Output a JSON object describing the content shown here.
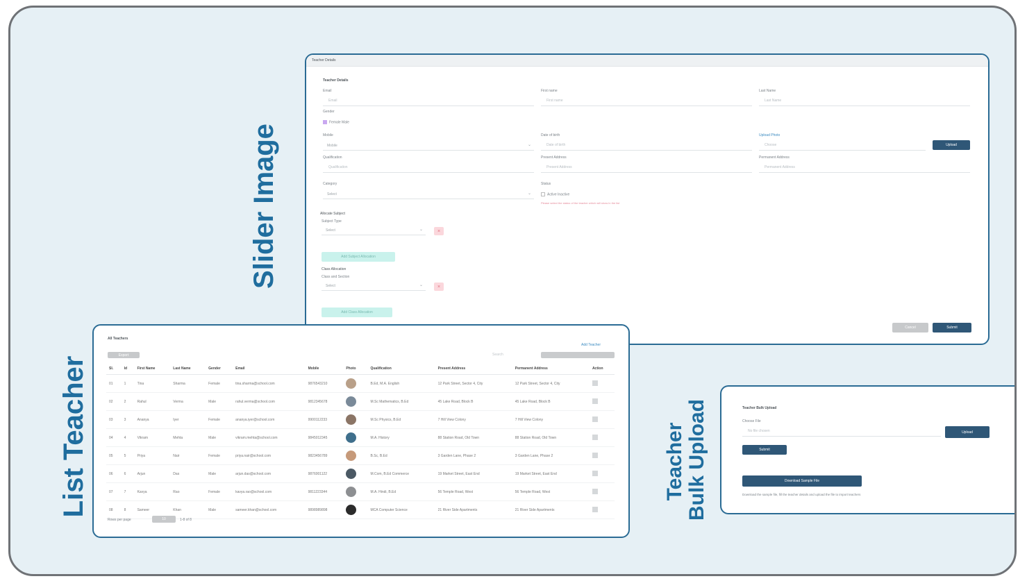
{
  "labels": {
    "slider_image": "Slider Image",
    "list_teacher": "List Teacher",
    "teacher_bulk_upload_line1": "Teacher",
    "teacher_bulk_upload_line2": "Bulk Upload"
  },
  "colors": {
    "accent": "#1f6d9e",
    "panel_border": "#2a6b94",
    "button_dark": "#2f5777",
    "button_mint": "#c9f2ec",
    "button_pink": "#fbd7dc",
    "frame_bg": "#e6f0f5"
  },
  "form_panel": {
    "topbar": "Teacher Details",
    "section_title": "Teacher Details",
    "email_label": "Email",
    "email_placeholder": "Email",
    "first_name_label": "First name",
    "first_name_placeholder": "First name",
    "last_name_label": "Last Name",
    "last_name_placeholder": "Last Name",
    "gender_label": "Gender",
    "gender_options": "Female Male",
    "mobile_label": "Mobile",
    "mobile_placeholder": "Mobile",
    "dob_label": "Date of birth",
    "dob_placeholder": "Date of birth",
    "upload_label": "Upload Photo",
    "upload_placeholder": "Choose",
    "upload_button": "Upload",
    "qualification_label": "Qualification",
    "qualification_placeholder": "Qualification",
    "present_address_label": "Present Address",
    "present_address_placeholder": "Present Address",
    "permanent_address_label": "Permanent Address",
    "permanent_address_placeholder": "Permanent Address",
    "category_label": "Category",
    "category_value": "Select",
    "status_label": "Status",
    "status_options": "Active Inactive",
    "status_hint": "Please select the status of the teacher which will show in the list",
    "subjects_title": "Allocate Subject",
    "subject_type_label": "Subject Type",
    "subject_type_value": "Select",
    "add_subject_button": "Add Subject Allocation",
    "class_title": "Class Allocation",
    "class_label": "Class and Section",
    "class_value": "Select",
    "add_class_button": "Add Class Allocation",
    "cancel_button": "Cancel",
    "submit_button": "Submit"
  },
  "list_panel": {
    "title": "All Teachers",
    "top_left_button": "Export",
    "search_placeholder": "Search",
    "link_text": "Add Teacher",
    "columns": [
      "Sl.",
      "Id",
      "First Name",
      "Last Name",
      "Gender",
      "Email",
      "Mobile",
      "Photo",
      "Qualification",
      "Present Address",
      "Permanent Address",
      "Action"
    ],
    "rows": [
      [
        "01",
        "1",
        "Tina",
        "Sharma",
        "Female",
        "tina.sharma@school.com",
        "9876543210",
        "",
        "B.Ed, M.A. English",
        "12 Park Street, Sector 4, City",
        "12 Park Street, Sector 4, City"
      ],
      [
        "02",
        "2",
        "Rahul",
        "Verma",
        "Male",
        "rahul.verma@school.com",
        "9812345678",
        "",
        "M.Sc Mathematics, B.Ed",
        "45 Lake Road, Block B",
        "45 Lake Road, Block B"
      ],
      [
        "03",
        "3",
        "Ananya",
        "Iyer",
        "Female",
        "ananya.iyer@school.com",
        "9900112233",
        "",
        "M.Sc Physics, B.Ed",
        "7 Hill View Colony",
        "7 Hill View Colony"
      ],
      [
        "04",
        "4",
        "Vikram",
        "Mehta",
        "Male",
        "vikram.mehta@school.com",
        "9845012345",
        "",
        "M.A. History",
        "88 Station Road, Old Town",
        "88 Station Road, Old Town"
      ],
      [
        "05",
        "5",
        "Priya",
        "Nair",
        "Female",
        "priya.nair@school.com",
        "9823456789",
        "",
        "B.Sc, B.Ed",
        "3 Garden Lane, Phase 2",
        "3 Garden Lane, Phase 2"
      ],
      [
        "06",
        "6",
        "Arjun",
        "Das",
        "Male",
        "arjun.das@school.com",
        "9876001122",
        "",
        "M.Com, B.Ed Commerce",
        "19 Market Street, East End",
        "19 Market Street, East End"
      ],
      [
        "07",
        "7",
        "Kavya",
        "Rao",
        "Female",
        "kavya.rao@school.com",
        "9811223344",
        "",
        "M.A. Hindi, B.Ed",
        "56 Temple Road, West",
        "56 Temple Road, West"
      ],
      [
        "08",
        "8",
        "Sameer",
        "Khan",
        "Male",
        "sameer.khan@school.com",
        "9898989898",
        "",
        "MCA Computer Science",
        "21 River Side Apartments",
        "21 River Side Apartments"
      ]
    ],
    "footer_left": "Rows per page",
    "footer_select": "10",
    "footer_right": "1-8 of 8"
  },
  "upload_panel": {
    "title": "Teacher Bulk Upload",
    "file_label": "Choose File",
    "file_placeholder": "No file chosen",
    "browse_button": "Upload",
    "upload_button": "Submit",
    "download_button": "Download Sample File",
    "note": "Download the sample file, fill the teacher details and upload the file to import teachers"
  }
}
